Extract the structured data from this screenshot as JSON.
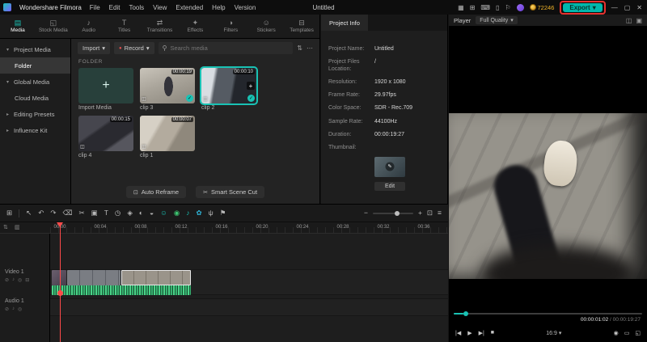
{
  "colors": {
    "accent": "#19c2b4",
    "export_teal": "#00b8ac",
    "annotation_red": "#e8312f",
    "waveform_green": "#3ecf8e",
    "playhead_red": "#ff4a4a",
    "coin_yellow": "#f0b429"
  },
  "icons": {
    "gift": "▦",
    "layout": "⊞",
    "keyboard": "⌨",
    "device": "▯",
    "bell": "⚐",
    "minimize": "—",
    "maximize": "▢",
    "close": "✕",
    "caret": "▾",
    "search": "⚲",
    "more": "⋯",
    "filter": "⇅",
    "record_dot": "●",
    "plus": "+",
    "check": "✓",
    "camera": "◫",
    "pencil": "✎",
    "corner_a": "⇅",
    "corner_b": "▥",
    "zoom_out": "−",
    "zoom_in": "+",
    "fit": "⊡",
    "track_menu": "≡"
  },
  "titlebar": {
    "app_name": "Wondershare Filmora",
    "menus": [
      "File",
      "Edit",
      "Tools",
      "View",
      "Extended",
      "Help",
      "Version"
    ],
    "document_title": "Untitled",
    "coin_count": "72246",
    "export_label": "Export"
  },
  "media_panel": {
    "tabs": [
      {
        "label": "Media",
        "icon": "▤"
      },
      {
        "label": "Stock Media",
        "icon": "◱"
      },
      {
        "label": "Audio",
        "icon": "♪"
      },
      {
        "label": "Titles",
        "icon": "T"
      },
      {
        "label": "Transitions",
        "icon": "⇄"
      },
      {
        "label": "Effects",
        "icon": "✦"
      },
      {
        "label": "Filters",
        "icon": "◑"
      },
      {
        "label": "Stickers",
        "icon": "☺"
      },
      {
        "label": "Templates",
        "icon": "⊟"
      }
    ],
    "sidebar": [
      {
        "chevron": "▾",
        "label": "Project Media"
      },
      {
        "chevron": "",
        "label": "Folder"
      },
      {
        "chevron": "▾",
        "label": "Global Media"
      },
      {
        "chevron": "",
        "label": "Cloud Media"
      },
      {
        "chevron": "▸",
        "label": "Editing Presets"
      },
      {
        "chevron": "▸",
        "label": "Influence Kit"
      }
    ],
    "toolbar": {
      "import_label": "Import",
      "record_label": "Record",
      "search_placeholder": "Search media"
    },
    "section_title": "FOLDER",
    "import_tile_label": "Import Media",
    "clips": [
      {
        "name": "clip 3",
        "duration": "00:00:19"
      },
      {
        "name": "clip 2",
        "duration": "00:00:10"
      },
      {
        "name": "clip 4",
        "duration": "00:00:15"
      },
      {
        "name": "clip 1",
        "duration": "00:00:07"
      }
    ],
    "footer": [
      {
        "icon": "⊡",
        "label": "Auto Reframe"
      },
      {
        "icon": "✂",
        "label": "Smart Scene Cut"
      }
    ]
  },
  "project_info": {
    "tab_label": "Project Info",
    "fields": [
      {
        "label": "Project Name:",
        "value": "Untitled"
      },
      {
        "label": "Project Files Location:",
        "value": "/"
      },
      {
        "label": "Resolution:",
        "value": "1920 x 1080"
      },
      {
        "label": "Frame Rate:",
        "value": "29.97fps"
      },
      {
        "label": "Color Space:",
        "value": "SDR - Rec.709"
      },
      {
        "label": "Sample Rate:",
        "value": "44100Hz"
      },
      {
        "label": "Duration:",
        "value": "00:00:19:27"
      },
      {
        "label": "Thumbnail:",
        "value": ""
      }
    ],
    "edit_button": "Edit"
  },
  "player": {
    "label": "Player",
    "quality": "Full Quality",
    "header_icons": {
      "pip": "◫",
      "detach": "▣"
    },
    "current_time": "00:00:01:02",
    "separator": "/",
    "total_time": "00:00:19:27",
    "transport": {
      "prev": "|◀",
      "play": "▶",
      "next": "▶|",
      "stop": "■"
    },
    "aspect_ratio": "16:9",
    "right_icons": {
      "snapshot": "◉",
      "mini": "▭",
      "fullscreen": "◱"
    }
  },
  "timeline": {
    "tools": [
      {
        "name": "layout-grid",
        "glyph": "⊞"
      },
      {
        "name": "select-tool",
        "glyph": "↖"
      },
      {
        "name": "undo",
        "glyph": "↶"
      },
      {
        "name": "redo",
        "glyph": "↷"
      },
      {
        "name": "delete",
        "glyph": "⌫"
      },
      {
        "name": "split",
        "glyph": "✂"
      },
      {
        "name": "crop",
        "glyph": "▣"
      },
      {
        "name": "text",
        "glyph": "T"
      },
      {
        "name": "speed",
        "glyph": "◷"
      },
      {
        "name": "keyframe",
        "glyph": "◈"
      },
      {
        "name": "color",
        "glyph": "◐"
      },
      {
        "name": "mask",
        "glyph": "◒"
      },
      {
        "name": "ai-portrait",
        "glyph": "☺"
      },
      {
        "name": "smart-cut",
        "glyph": "◉"
      },
      {
        "name": "ai-audio",
        "glyph": "♪"
      },
      {
        "name": "ai-color",
        "glyph": "✿"
      },
      {
        "name": "mic",
        "glyph": "ψ"
      },
      {
        "name": "marker",
        "glyph": "⚑"
      }
    ],
    "ruler_marks": [
      "00:00",
      "00:04",
      "00:08",
      "00:12",
      "00:16",
      "00:20",
      "00:24",
      "00:28",
      "00:32",
      "00:36"
    ],
    "tracks": [
      {
        "name": "Video 1",
        "icons": [
          "⊘",
          "♪",
          "◎",
          "⊟"
        ]
      },
      {
        "name": "Audio 1",
        "icons": [
          "⊘",
          "♪",
          "◎"
        ]
      }
    ]
  }
}
